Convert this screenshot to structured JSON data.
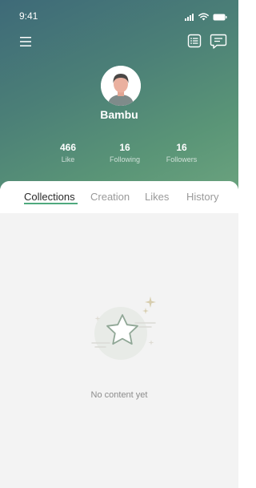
{
  "status_bar": {
    "time": "9:41",
    "icons": [
      "signal-icon",
      "wifi-icon",
      "battery-icon"
    ]
  },
  "header": {
    "icons": [
      "menu-icon",
      "notes-icon",
      "message-icon"
    ]
  },
  "profile": {
    "username": "Bambu",
    "avatar_icon": "person-avatar"
  },
  "stats": [
    {
      "value": "466",
      "label": "Like"
    },
    {
      "value": "16",
      "label": "Following"
    },
    {
      "value": "16",
      "label": "Followers"
    }
  ],
  "tabs": [
    {
      "label": "Collections",
      "active": true
    },
    {
      "label": "Creation",
      "active": false
    },
    {
      "label": "Likes",
      "active": false
    },
    {
      "label": "History",
      "active": false
    }
  ],
  "empty_state": {
    "icon": "star-icon",
    "message": "No content yet"
  },
  "colors": {
    "accent": "#4fa97d",
    "header_gradient_start": "#3e6a78",
    "header_gradient_end": "#6aa27e",
    "content_background": "#f3f3f3"
  }
}
